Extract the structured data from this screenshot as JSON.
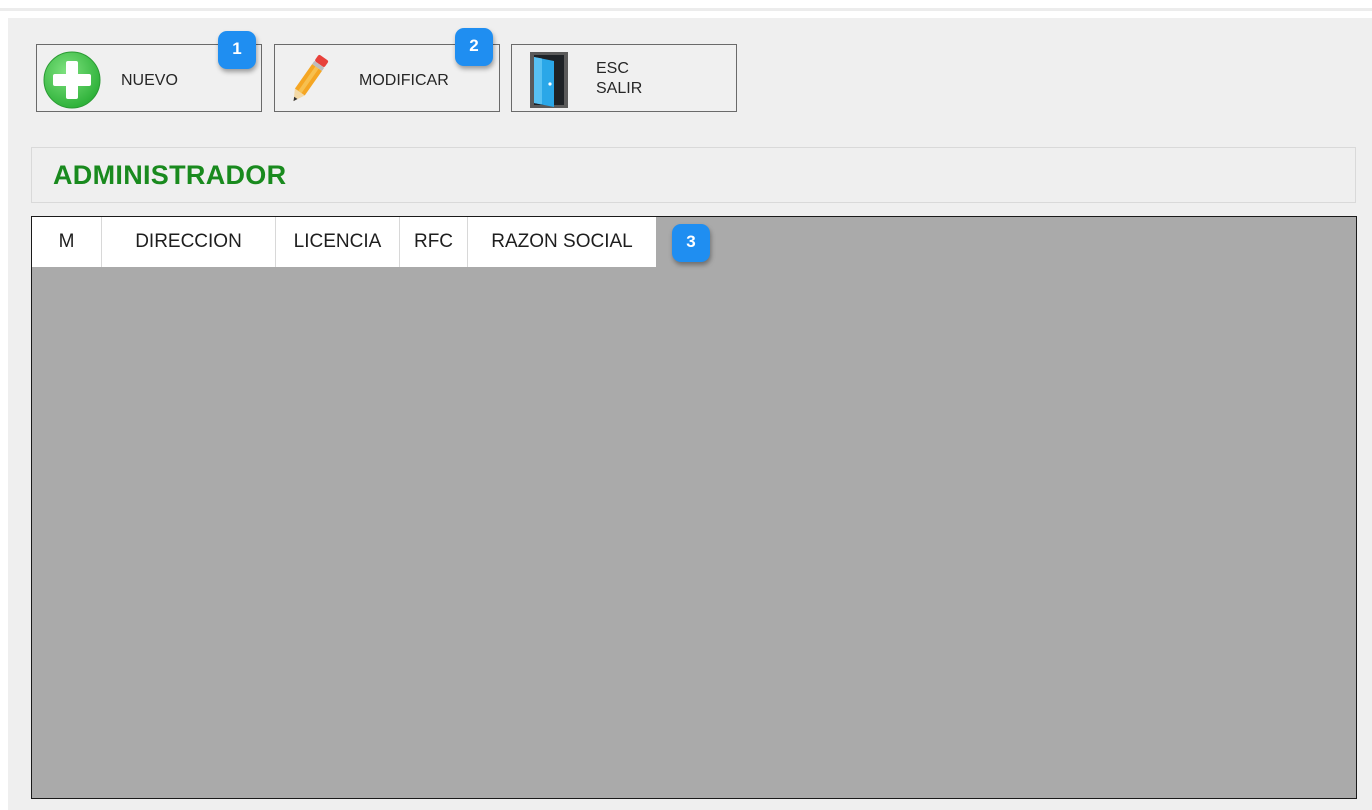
{
  "toolbar": {
    "nuevo": {
      "label": "NUEVO",
      "icon": "plus-circle-icon",
      "color": "#3ac43f"
    },
    "modificar": {
      "label": "MODIFICAR",
      "icon": "pencil-icon"
    },
    "salir": {
      "label": "ESC\nSALIR",
      "icon": "door-icon"
    }
  },
  "badges": [
    "1",
    "2",
    "3"
  ],
  "badge_color": "#1f8ef1",
  "page_title": "ADMINISTRADOR",
  "title_color": "#198a1e",
  "grid": {
    "columns": [
      "M",
      "DIRECCION",
      "LICENCIA",
      "RFC",
      "RAZON SOCIAL"
    ],
    "background": "#aaaaaa"
  }
}
